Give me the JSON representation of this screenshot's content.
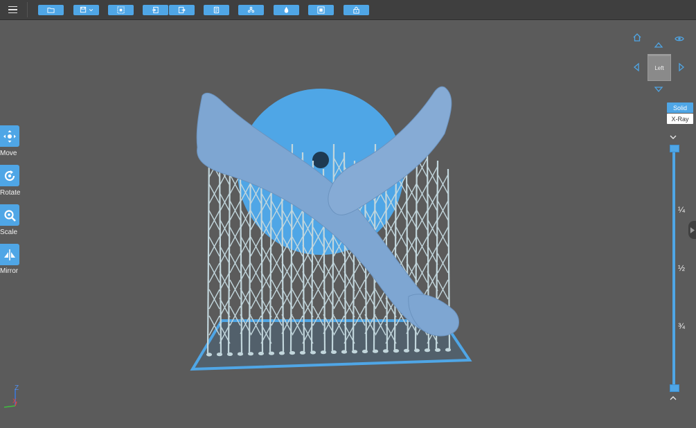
{
  "colors": {
    "accent": "#4fa6e6",
    "background": "#5b5b5b",
    "topbar": "#3f3f3f",
    "model": "#7ea6d2",
    "supports": "#c2d6dc"
  },
  "toolbar": {
    "menu_icon": "hamburger-icon",
    "buttons": [
      {
        "name": "open-file-button",
        "icon": "folder-icon"
      },
      {
        "name": "save-button",
        "icon": "save-icon"
      },
      {
        "name": "select-all-button",
        "icon": "select-icon"
      },
      {
        "name": "import-button",
        "icon": "import-icon"
      },
      {
        "name": "export-button",
        "icon": "export-icon"
      },
      {
        "name": "copy-button",
        "icon": "copy-icon"
      },
      {
        "name": "supports-button",
        "icon": "supports-icon"
      },
      {
        "name": "fill-button",
        "icon": "drop-icon"
      },
      {
        "name": "hollow-button",
        "icon": "hollow-icon"
      },
      {
        "name": "slice-button",
        "icon": "lock-icon"
      }
    ]
  },
  "tools": [
    {
      "label": "Move",
      "icon": "move-icon"
    },
    {
      "label": "Rotate",
      "icon": "rotate-icon"
    },
    {
      "label": "Scale",
      "icon": "scale-icon"
    },
    {
      "label": "Mirror",
      "icon": "mirror-icon"
    }
  ],
  "view_cube": {
    "face": "Left"
  },
  "display_mode": {
    "solid": "Solid",
    "xray": "X-Ray",
    "selected": "Solid"
  },
  "layer_slider": {
    "marks": [
      "¼",
      "½",
      "¾"
    ],
    "top_fraction": 1.0,
    "bottom_fraction": 0.0
  },
  "axes": {
    "z": "Z",
    "x": "X"
  }
}
